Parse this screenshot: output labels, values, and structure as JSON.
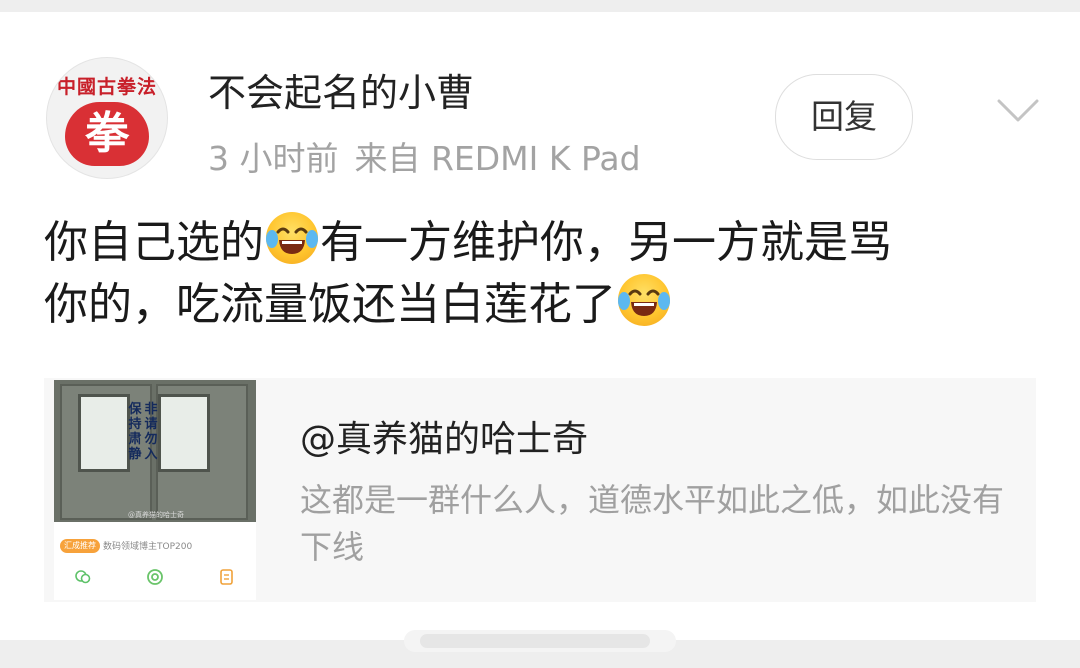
{
  "post": {
    "username": "不会起名的小曹",
    "time": "3 小时前",
    "source": "来自 REDMI K Pad",
    "reply_label": "回复",
    "text_line1_a": "你自己选的",
    "text_line1_b": "有一方维护你，另一方就是骂",
    "text_line2_a": "你的，吃流量饭还当白莲花了"
  },
  "avatar": {
    "ring_text": "中國古拳法",
    "seal_char": "拳"
  },
  "quoted": {
    "title": "@真养猫的哈士奇",
    "description": "这都是一群什么人，道德水平如此之低，如此没有下线",
    "thumbnail": {
      "sign_left": "保持肃静",
      "sign_right": "非请勿入",
      "watermark": "@真养猫的哈士奇",
      "tag": "汇成推荐",
      "tag_text": "数码领域博主TOP200"
    }
  },
  "icons": {
    "emoji": "laughing-tears-emoji",
    "menu": "chevron-down-icon"
  },
  "colors": {
    "name": "#222222",
    "meta": "#a3a3a3",
    "card_bg": "#f7f7f7",
    "emoji": "#ffc52e",
    "tag": "#f7a23b"
  }
}
